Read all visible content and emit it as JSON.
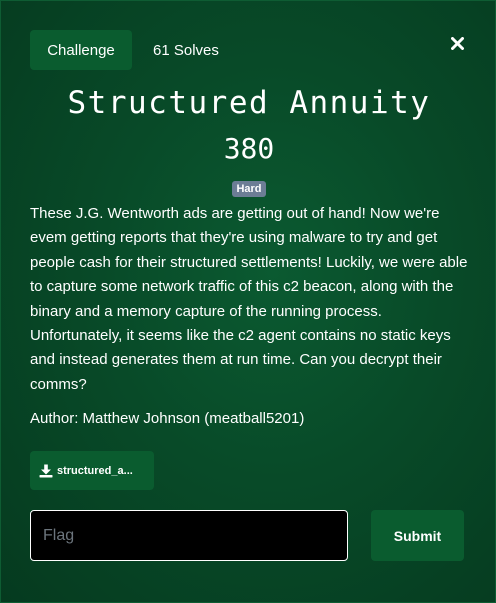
{
  "tabs": {
    "challenge_label": "Challenge",
    "solves_label": "61 Solves"
  },
  "challenge": {
    "name": "Structured Annuity",
    "points": "380",
    "difficulty": "Hard",
    "description": "These J.G. Wentworth ads are getting out of hand! Now we're evem getting reports that they're using malware to try and get people cash for their structured settlements! Luckily, we were able to capture some network traffic of this c2 beacon, along with the binary and a memory capture of the running process. Unfortunately, it seems like the c2 agent contains no static keys and instead generates them at run time. Can you decrypt their comms?",
    "author": "Author: Matthew Johnson (meatball5201)",
    "file_label": "structured_a..."
  },
  "form": {
    "flag_placeholder": "Flag",
    "flag_value": "",
    "submit_label": "Submit"
  },
  "icons": {
    "close": "close-icon",
    "download": "download-icon"
  },
  "colors": {
    "background": "#084a28",
    "button": "#0a5c2f",
    "badge": "#6c7d95",
    "input_bg": "#000000",
    "text": "#ffffff"
  }
}
